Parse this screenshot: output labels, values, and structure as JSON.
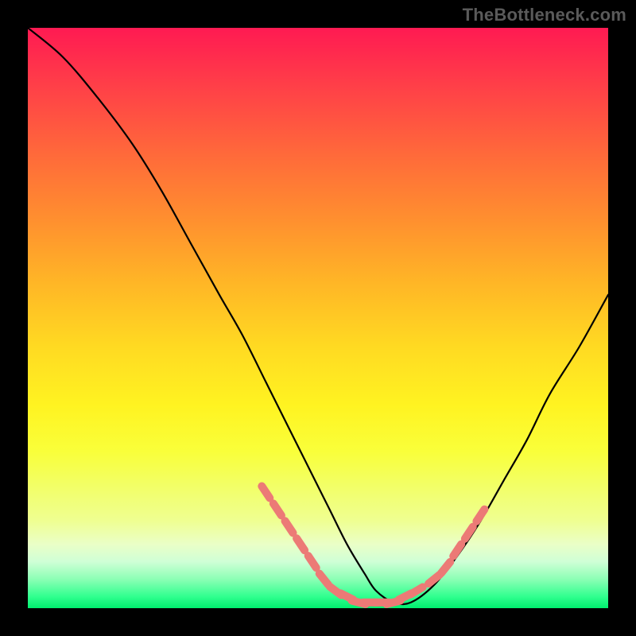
{
  "watermark": {
    "text": "TheBottleneck.com"
  },
  "colors": {
    "background": "#000000",
    "curve_stroke": "#000000",
    "marker_fill": "#ec7a76",
    "gradient_top": "#ff1a52",
    "gradient_mid": "#ffda22",
    "gradient_bottom": "#00ef6e"
  },
  "chart_data": {
    "type": "line",
    "title": "",
    "xlabel": "",
    "ylabel": "",
    "x_range": [
      0,
      100
    ],
    "y_range": [
      0,
      100
    ],
    "series": [
      {
        "name": "bottleneck-curve",
        "x": [
          0,
          6,
          12,
          18,
          23,
          28,
          33,
          37,
          41,
          45,
          49,
          52,
          55,
          58,
          60,
          63,
          66,
          70,
          74,
          78,
          82,
          86,
          90,
          95,
          100
        ],
        "values": [
          100,
          95,
          88,
          80,
          72,
          63,
          54,
          47,
          39,
          31,
          23,
          17,
          11,
          6,
          3,
          1,
          1,
          4,
          9,
          15,
          22,
          29,
          37,
          45,
          54
        ]
      }
    ],
    "markers": {
      "name": "highlighted-points",
      "x": [
        41,
        43,
        45,
        47,
        49,
        51,
        53,
        55,
        57,
        59,
        61,
        63,
        65,
        67,
        70,
        72,
        74,
        76,
        78
      ],
      "values": [
        20,
        17,
        14,
        11,
        8,
        5,
        3,
        2,
        1,
        1,
        1,
        1,
        2,
        3,
        5,
        7,
        10,
        13,
        16
      ]
    }
  }
}
